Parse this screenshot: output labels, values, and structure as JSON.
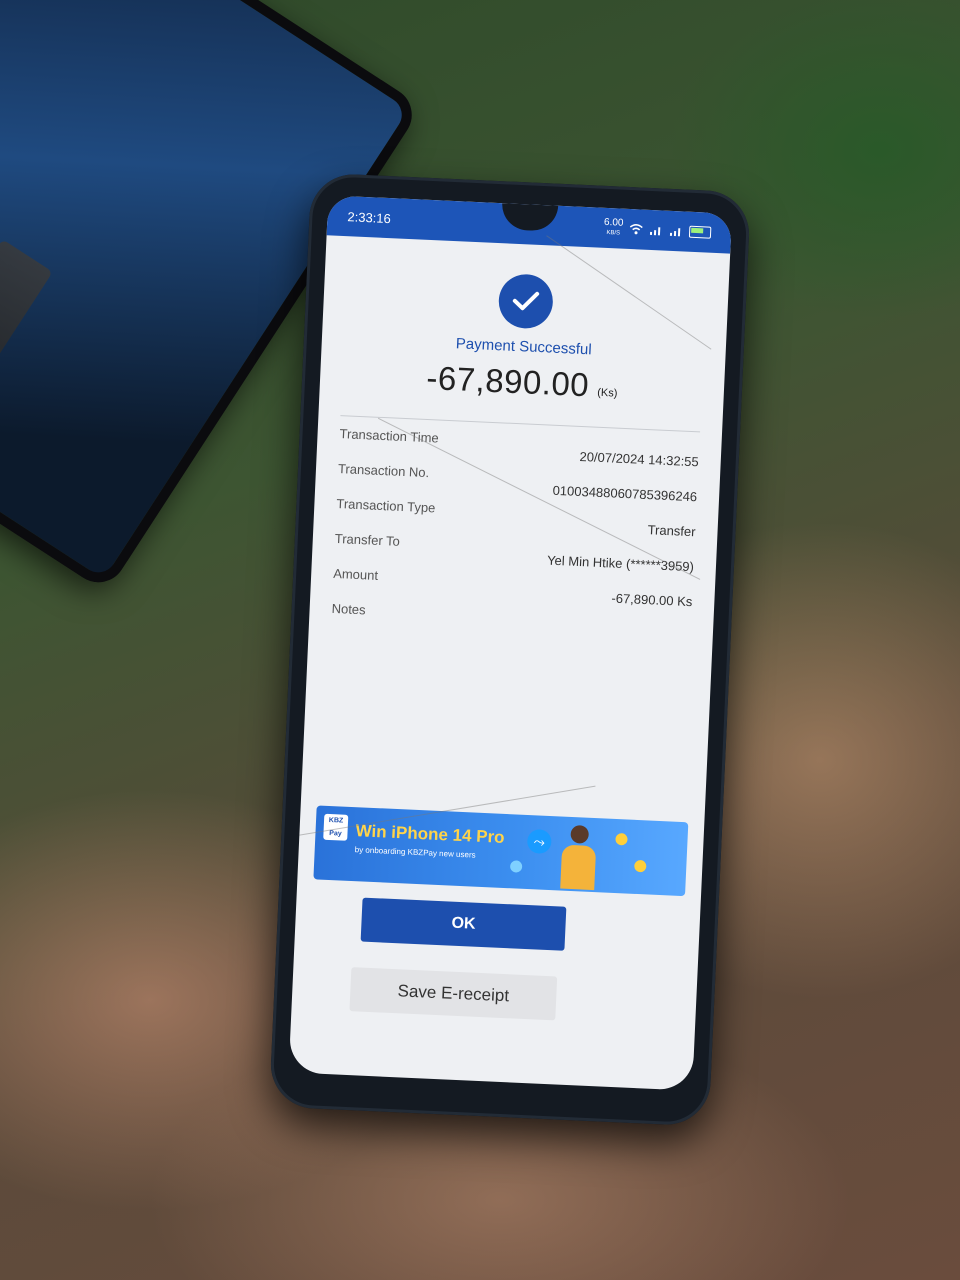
{
  "status_bar": {
    "time": "2:33:16",
    "network_speed": "6.00",
    "network_speed_unit": "KB/S",
    "icons": [
      "wifi-icon",
      "signal-icon",
      "signal-icon",
      "battery-icon"
    ]
  },
  "receipt": {
    "title": "Payment Successful",
    "amount": "-67,890.00",
    "currency": "(Ks)",
    "rows": [
      {
        "label": "Transaction Time",
        "value": "20/07/2024 14:32:55"
      },
      {
        "label": "Transaction No.",
        "value": "01003488060785396246"
      },
      {
        "label": "Transaction Type",
        "value": "Transfer"
      },
      {
        "label": "Transfer To",
        "value": "Yel Min Htike (******3959)"
      },
      {
        "label": "Amount",
        "value": "-67,890.00 Ks"
      },
      {
        "label": "Notes",
        "value": ""
      }
    ]
  },
  "banner": {
    "logo_top": "KBZ",
    "logo_bottom": "Pay",
    "title": "Win iPhone 14 Pro",
    "subtitle": "by onboarding KBZPay new users"
  },
  "buttons": {
    "ok_label": "OK",
    "save_label": "Save E-receipt"
  },
  "colors": {
    "brand_blue": "#1d4fae",
    "status_bar": "#1d55b8"
  }
}
